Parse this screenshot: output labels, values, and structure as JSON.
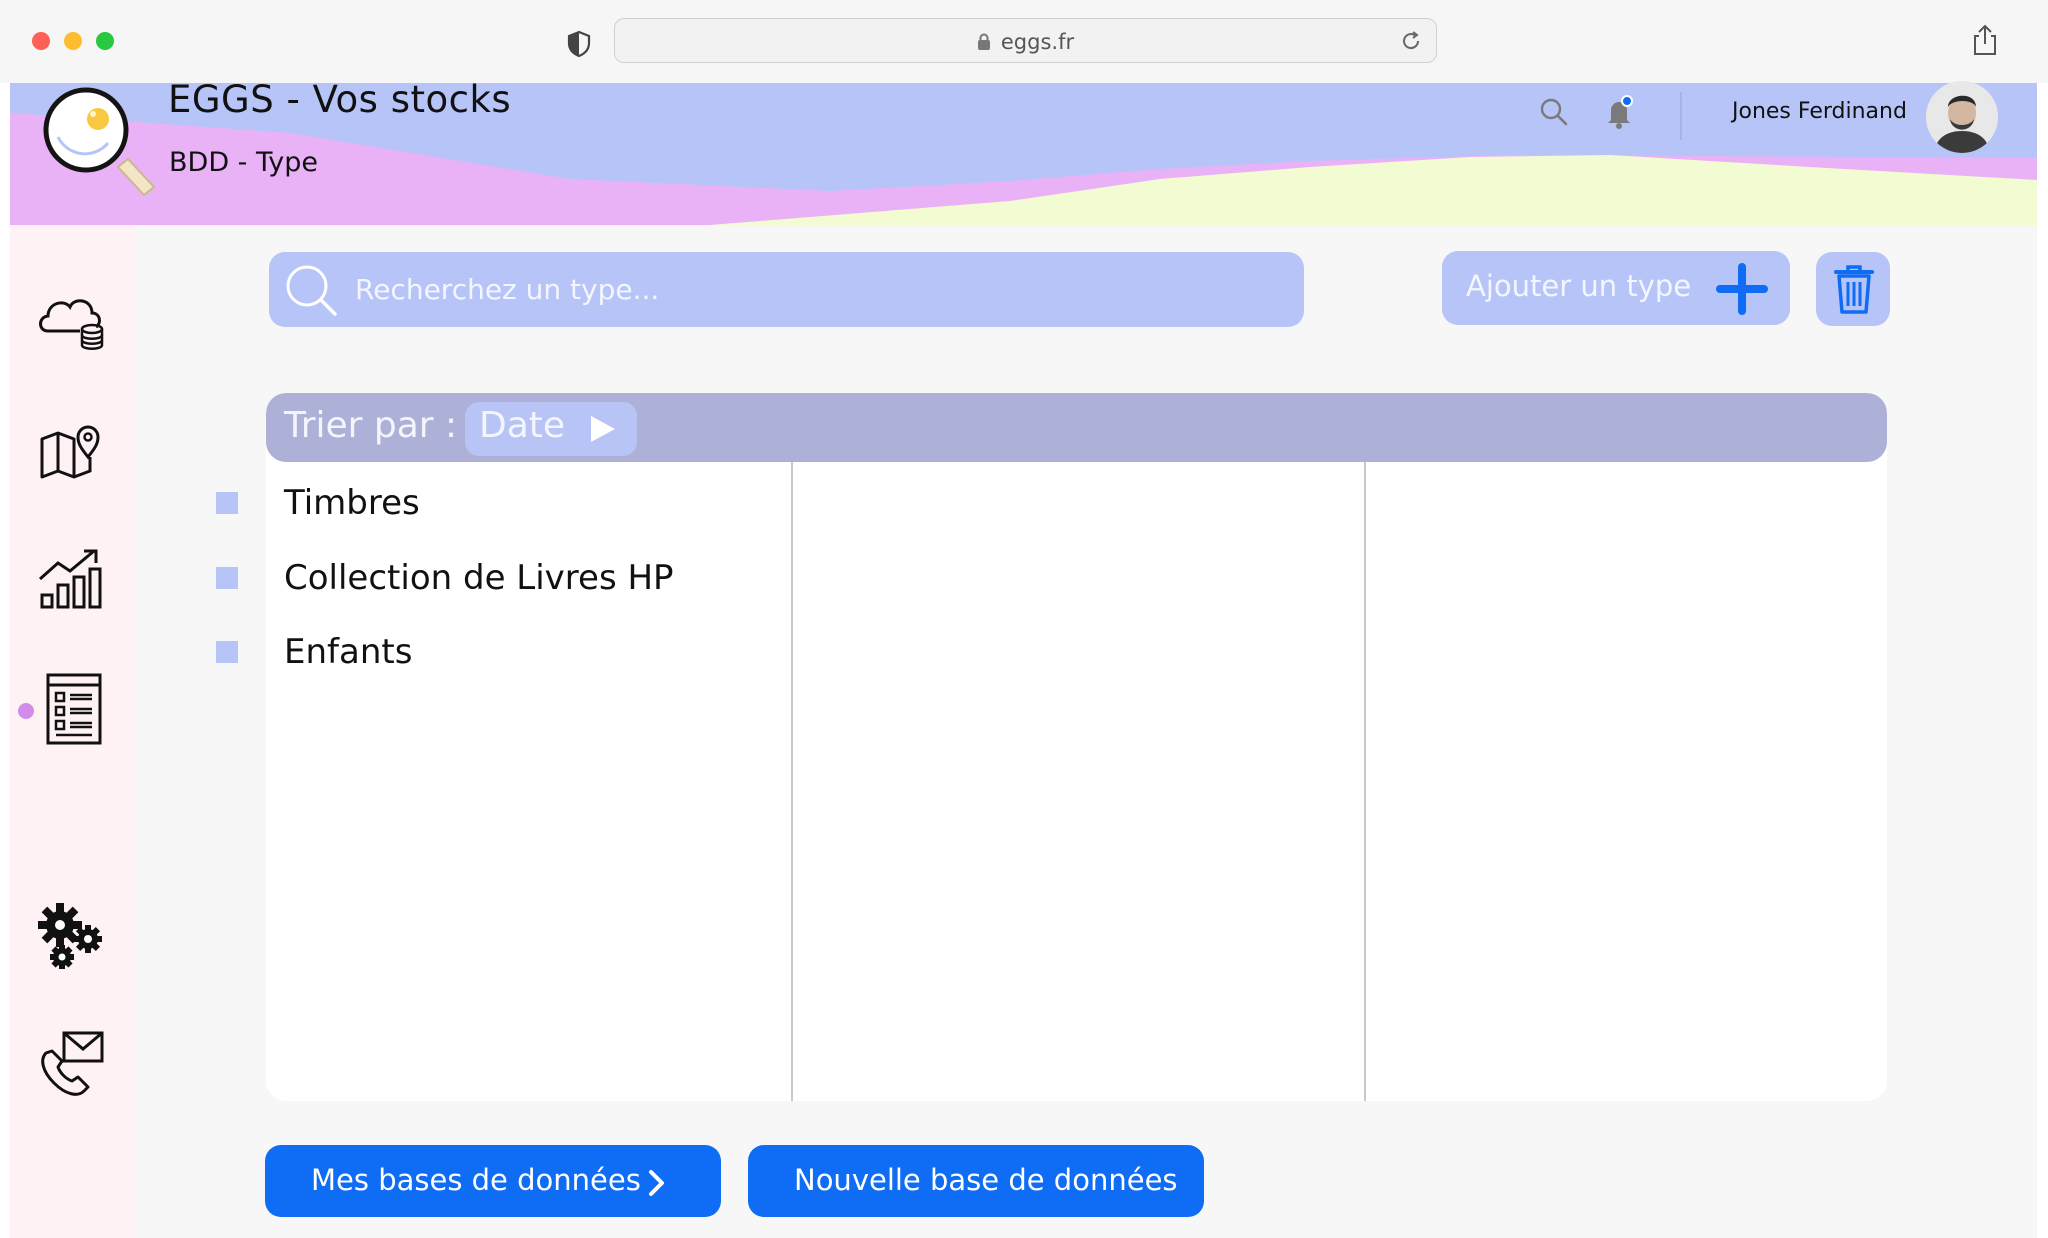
{
  "browser": {
    "url": "eggs.fr"
  },
  "header": {
    "title": "EGGS - Vos stocks",
    "subtitle": "BDD - Type",
    "user_name": "Jones Ferdinand"
  },
  "sidebar": {
    "items": [
      {
        "icon": "cloud-database-icon"
      },
      {
        "icon": "map-location-icon"
      },
      {
        "icon": "growth-chart-icon"
      },
      {
        "icon": "checklist-document-icon",
        "active": true
      },
      {
        "icon": "gears-icon"
      },
      {
        "icon": "phone-mail-icon"
      }
    ]
  },
  "search": {
    "placeholder": "Recherchez un type..."
  },
  "toolbar": {
    "add_label": "Ajouter un type"
  },
  "sort": {
    "label": "Trier par :",
    "value": "Date"
  },
  "types": [
    "Timbres",
    "Collection de Livres HP",
    "Enfants"
  ],
  "footer": {
    "my_databases": "Mes bases de données",
    "new_database": "Nouvelle base de données"
  },
  "colors": {
    "header_blue": "#b7c4f7",
    "header_pink": "#e9b2f7",
    "header_yellow": "#f3fbd2",
    "primary_blue": "#0f6cf4",
    "sortbar": "#aeb1d7",
    "active_dot": "#d18de9"
  }
}
